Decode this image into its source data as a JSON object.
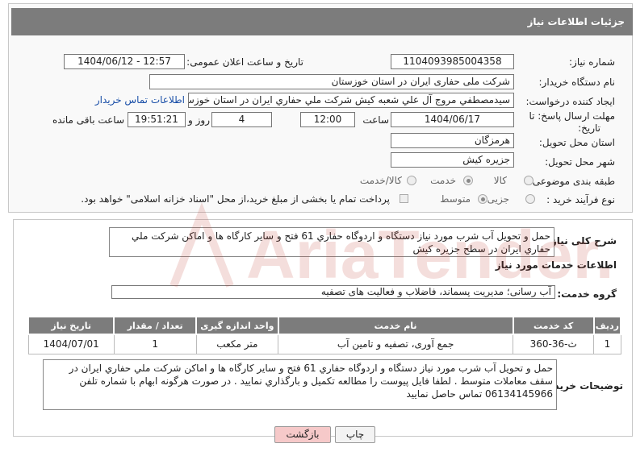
{
  "header": {
    "title": "جزئیات اطلاعات نیاز"
  },
  "fields": {
    "need_number": {
      "label": "شماره نیاز:",
      "value": "1104093985004358"
    },
    "announce_datetime": {
      "label": "تاریخ و ساعت اعلان عمومی:",
      "value": "1404/06/12 - 12:57"
    },
    "buyer_org": {
      "label": "نام دستگاه خریدار:",
      "value": "شرکت ملی حفاری ایران در استان خوزستان"
    },
    "requester": {
      "label": "ایجاد کننده درخواست:",
      "value": "سیدمصطفي مروج آل علي شعبه كيش شركت ملي حفاري ايران در استان خوزستان",
      "contact_link": "اطلاعات تماس خریدار"
    },
    "deadline": {
      "label_line1": "مهلت ارسال پاسخ: تا",
      "label_line2": "تاریخ:",
      "date": "1404/06/17",
      "time_label": "ساعت",
      "time": "12:00",
      "days": "4",
      "days_label": "روز و",
      "remaining": "19:51:21",
      "remaining_label": "ساعت باقی مانده"
    },
    "province": {
      "label": "استان محل تحویل:",
      "value": "هرمزگان"
    },
    "city": {
      "label": "شهر محل تحویل:",
      "value": "جزیره کیش"
    },
    "category": {
      "label": "طبقه بندی موضوعی:",
      "options": [
        "کالا",
        "خدمت",
        "کالا/خدمت"
      ],
      "selected": "خدمت"
    },
    "process": {
      "label": "نوع فرآیند خرید :",
      "options": [
        "جزیی",
        "متوسط"
      ],
      "selected": "متوسط",
      "payment_note": "پرداخت تمام یا بخشی از مبلغ خرید،از محل \"اسناد خزانه اسلامی\" خواهد بود."
    }
  },
  "summary": {
    "label": "شرح کلی نیاز:",
    "text": "حمل و تحويل آب شرب مورد نياز دستگاه  و اردوگاه حفاري 61 فتح و ساير كارگاه ها و اماكن شركت ملي حفاري ايران در سطح جزيره كيش"
  },
  "services": {
    "title": "اطلاعات خدمات مورد نیاز",
    "group_label": "گروه خدمت:",
    "group_value": "آب رسانی؛ مدیریت پسماند، فاضلاب و فعالیت های تصفیه",
    "columns": [
      "ردیف",
      "کد خدمت",
      "نام خدمت",
      "واحد اندازه گیری",
      "تعداد / مقدار",
      "تاریخ نیاز"
    ],
    "rows": [
      {
        "row": "1",
        "code": "ث-36-360",
        "name": "جمع آوری، تصفیه و تامین آب",
        "unit": "متر مکعب",
        "qty": "1",
        "date": "1404/07/01"
      }
    ]
  },
  "buyer_notes": {
    "label": "توضیحات خریدار:",
    "text": "حمل و تحويل آب شرب مورد نياز دستگاه و اردوگاه حفاري 61 فتح و ساير كارگاه ها و اماكن شركت ملي حفاري ايران  در سقف معاملات متوسط . لطفا فايل پيوست را  مطالعه تكميل و بارگذاري نماييد . در صورت هرگونه ابهام با شماره تلفن 06134145966 تماس حاصل نماييد"
  },
  "buttons": {
    "print": "چاپ",
    "back": "بازگشت"
  },
  "watermark": {
    "text": "AriaTender.net"
  },
  "colors": {
    "header_bg": "#7c7c7c",
    "link": "#1a4fa8",
    "back_button": "#f6c9c9",
    "watermark": "#c0392b"
  }
}
